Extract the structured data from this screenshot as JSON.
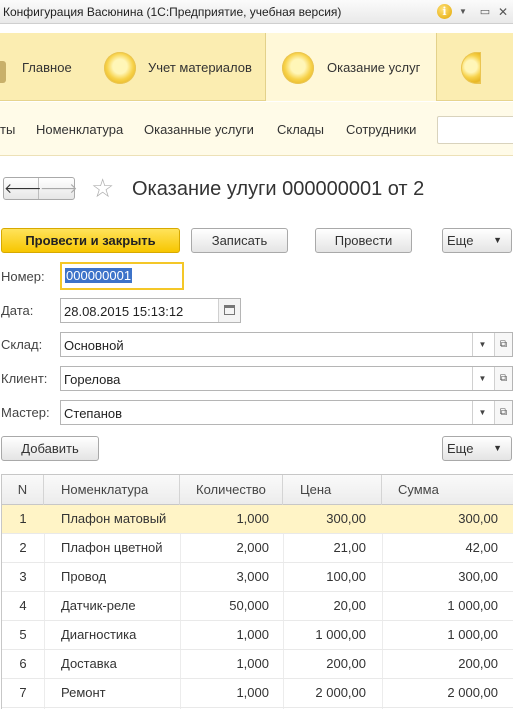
{
  "window": {
    "title": "Конфигурация Васюнина  (1С:Предприятие, учебная версия)"
  },
  "sections": [
    {
      "label": "Главное",
      "active": false
    },
    {
      "label": "Учет материалов",
      "active": false
    },
    {
      "label": "Оказание услуг",
      "active": true
    }
  ],
  "nav": {
    "items": [
      "ты",
      "Номенклатура",
      "Оказанные услуги",
      "Склады",
      "Сотрудники"
    ]
  },
  "form": {
    "title": "Оказание улуги 000000001 от 2",
    "commands": {
      "post_and_close": "Провести и закрыть",
      "save": "Записать",
      "post": "Провести",
      "more": "Еще"
    },
    "fields": {
      "number_label": "Номер:",
      "number_value": "000000001",
      "date_label": "Дата:",
      "date_value": "28.08.2015 15:13:12",
      "warehouse_label": "Склад:",
      "warehouse_value": "Основной",
      "client_label": "Клиент:",
      "client_value": "Горелова",
      "master_label": "Мастер:",
      "master_value": "Степанов"
    },
    "table_commands": {
      "add": "Добавить",
      "more": "Еще"
    }
  },
  "table": {
    "columns": [
      "N",
      "Номенклатура",
      "Количество",
      "Цена",
      "Сумма"
    ],
    "rows": [
      {
        "n": "1",
        "item": "Плафон матовый",
        "qty": "1,000",
        "price": "300,00",
        "sum": "300,00"
      },
      {
        "n": "2",
        "item": "Плафон цветной",
        "qty": "2,000",
        "price": "21,00",
        "sum": "42,00"
      },
      {
        "n": "3",
        "item": "Провод",
        "qty": "3,000",
        "price": "100,00",
        "sum": "300,00"
      },
      {
        "n": "4",
        "item": "Датчик-реле",
        "qty": "50,000",
        "price": "20,00",
        "sum": "1 000,00"
      },
      {
        "n": "5",
        "item": "Диагностика",
        "qty": "1,000",
        "price": "1 000,00",
        "sum": "1 000,00"
      },
      {
        "n": "6",
        "item": "Доставка",
        "qty": "1,000",
        "price": "200,00",
        "sum": "200,00"
      },
      {
        "n": "7",
        "item": "Ремонт",
        "qty": "1,000",
        "price": "2 000,00",
        "sum": "2 000,00"
      }
    ],
    "selected_row": 1
  },
  "colors": {
    "sections_bg": "#fbedb1",
    "primary_button": "#f7c600",
    "selection": "#3d73c9",
    "selected_row": "#fff4c6"
  }
}
